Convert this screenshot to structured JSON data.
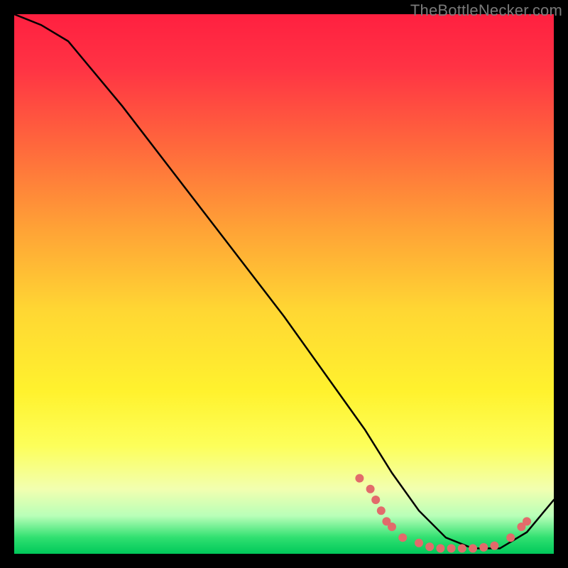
{
  "watermark": "TheBottleNecker.com",
  "chart_data": {
    "type": "line",
    "title": "",
    "xlabel": "",
    "ylabel": "",
    "xlim": [
      0,
      100
    ],
    "ylim": [
      0,
      100
    ],
    "series": [
      {
        "name": "curve",
        "x": [
          0,
          5,
          10,
          20,
          30,
          40,
          50,
          60,
          65,
          70,
          75,
          80,
          85,
          90,
          95,
          100
        ],
        "y": [
          100,
          98,
          95,
          83,
          70,
          57,
          44,
          30,
          23,
          15,
          8,
          3,
          1,
          1,
          4,
          10
        ]
      }
    ],
    "markers": {
      "name": "dots",
      "color": "#e26b6b",
      "points": [
        {
          "x": 64,
          "y": 14
        },
        {
          "x": 66,
          "y": 12
        },
        {
          "x": 67,
          "y": 10
        },
        {
          "x": 68,
          "y": 8
        },
        {
          "x": 69,
          "y": 6
        },
        {
          "x": 70,
          "y": 5
        },
        {
          "x": 72,
          "y": 3
        },
        {
          "x": 75,
          "y": 2
        },
        {
          "x": 77,
          "y": 1.3
        },
        {
          "x": 79,
          "y": 1
        },
        {
          "x": 81,
          "y": 1
        },
        {
          "x": 83,
          "y": 1
        },
        {
          "x": 85,
          "y": 1
        },
        {
          "x": 87,
          "y": 1.2
        },
        {
          "x": 89,
          "y": 1.5
        },
        {
          "x": 92,
          "y": 3
        },
        {
          "x": 94,
          "y": 5
        },
        {
          "x": 95,
          "y": 6
        }
      ]
    }
  }
}
